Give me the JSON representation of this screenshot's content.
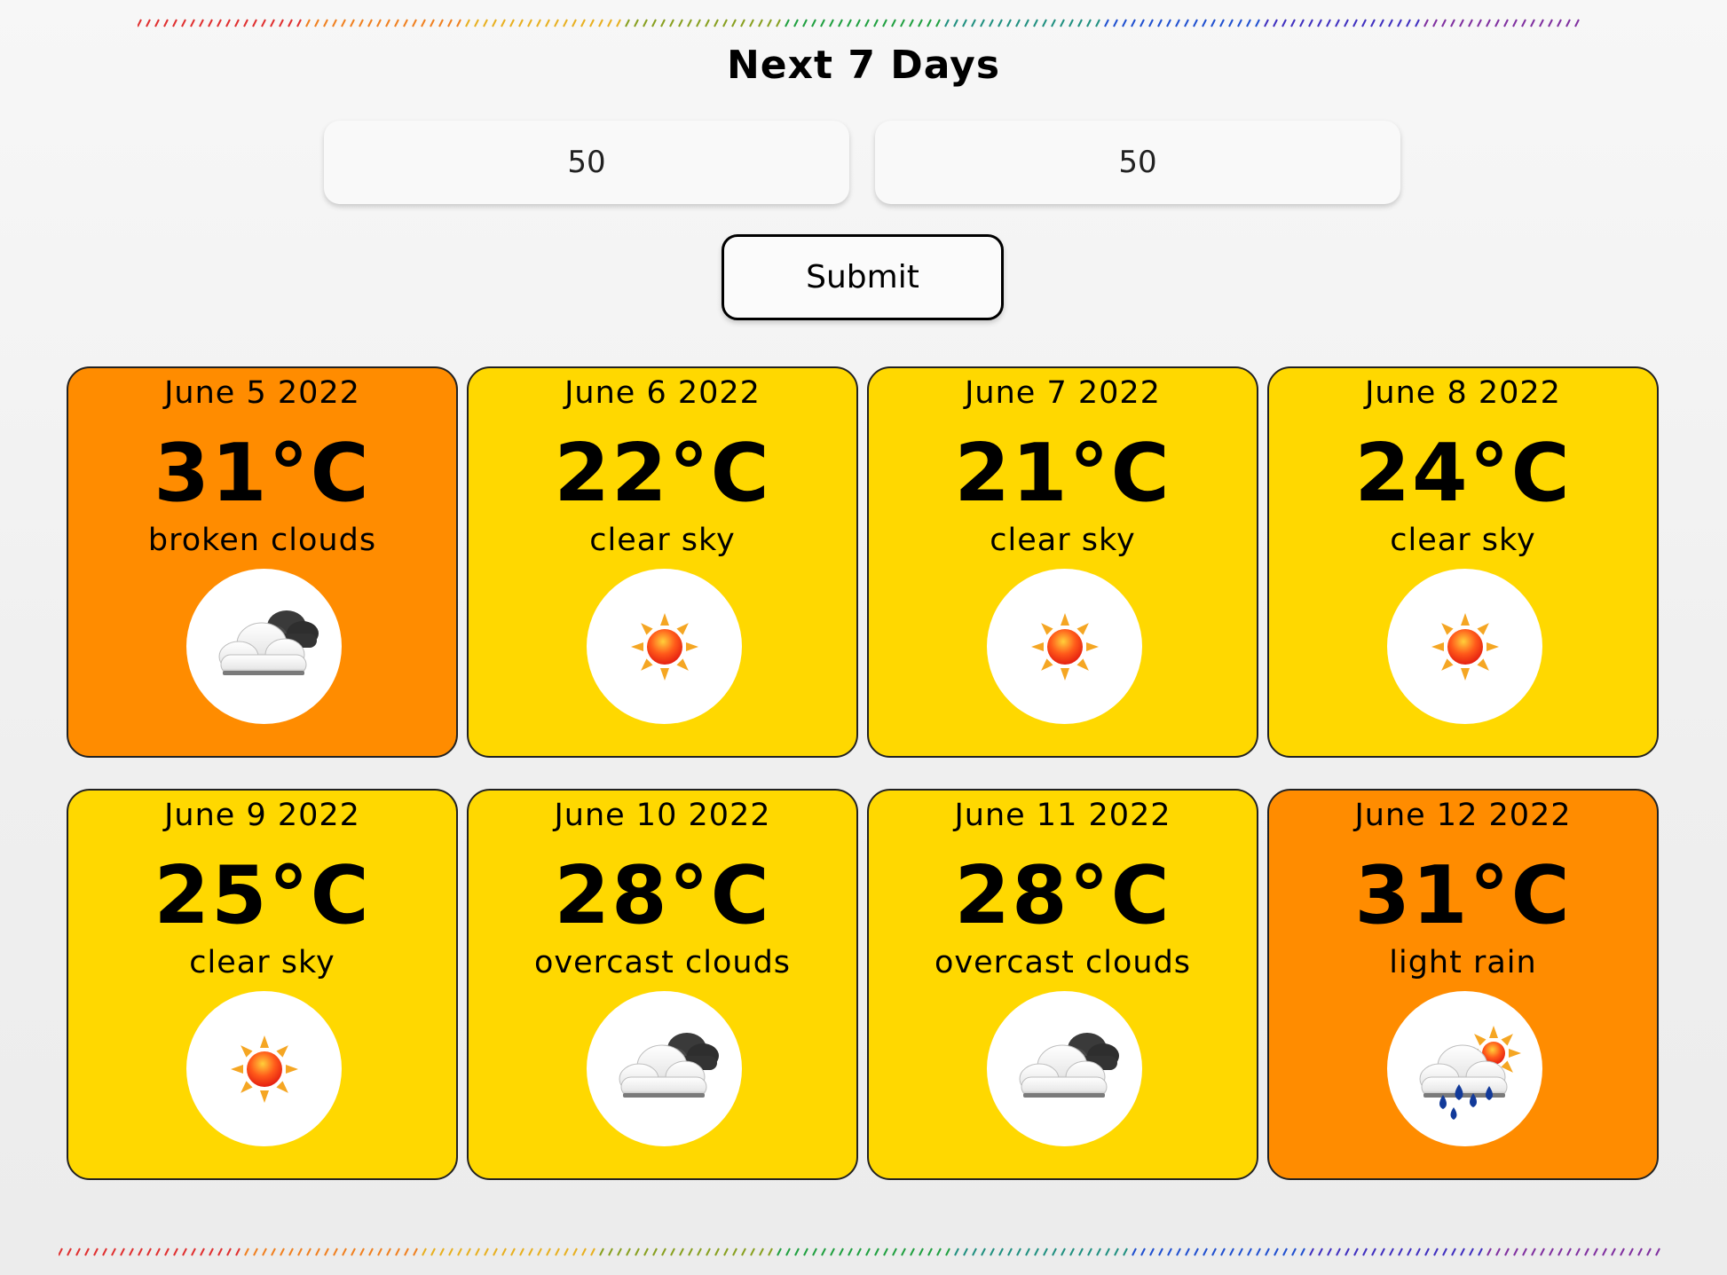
{
  "header": {
    "title": "Next 7 Days"
  },
  "form": {
    "latitude_value": "50",
    "longitude_value": "50",
    "submit_label": "Submit"
  },
  "colors": {
    "hot_card": "#ff8c00",
    "warm_card": "#ffd800"
  },
  "forecast": [
    {
      "date": "June 5 2022",
      "temp": "31°C",
      "description": "broken clouds",
      "icon": "broken-clouds-icon",
      "tone": "hot"
    },
    {
      "date": "June 6 2022",
      "temp": "22°C",
      "description": "clear sky",
      "icon": "sun-icon",
      "tone": "warm"
    },
    {
      "date": "June 7 2022",
      "temp": "21°C",
      "description": "clear sky",
      "icon": "sun-icon",
      "tone": "warm"
    },
    {
      "date": "June 8 2022",
      "temp": "24°C",
      "description": "clear sky",
      "icon": "sun-icon",
      "tone": "warm"
    },
    {
      "date": "June 9 2022",
      "temp": "25°C",
      "description": "clear sky",
      "icon": "sun-icon",
      "tone": "warm"
    },
    {
      "date": "June 10 2022",
      "temp": "28°C",
      "description": "overcast clouds",
      "icon": "overcast-clouds-icon",
      "tone": "warm"
    },
    {
      "date": "June 11 2022",
      "temp": "28°C",
      "description": "overcast clouds",
      "icon": "overcast-clouds-icon",
      "tone": "warm"
    },
    {
      "date": "June 12 2022",
      "temp": "31°C",
      "description": "light rain",
      "icon": "light-rain-icon",
      "tone": "hot"
    }
  ]
}
